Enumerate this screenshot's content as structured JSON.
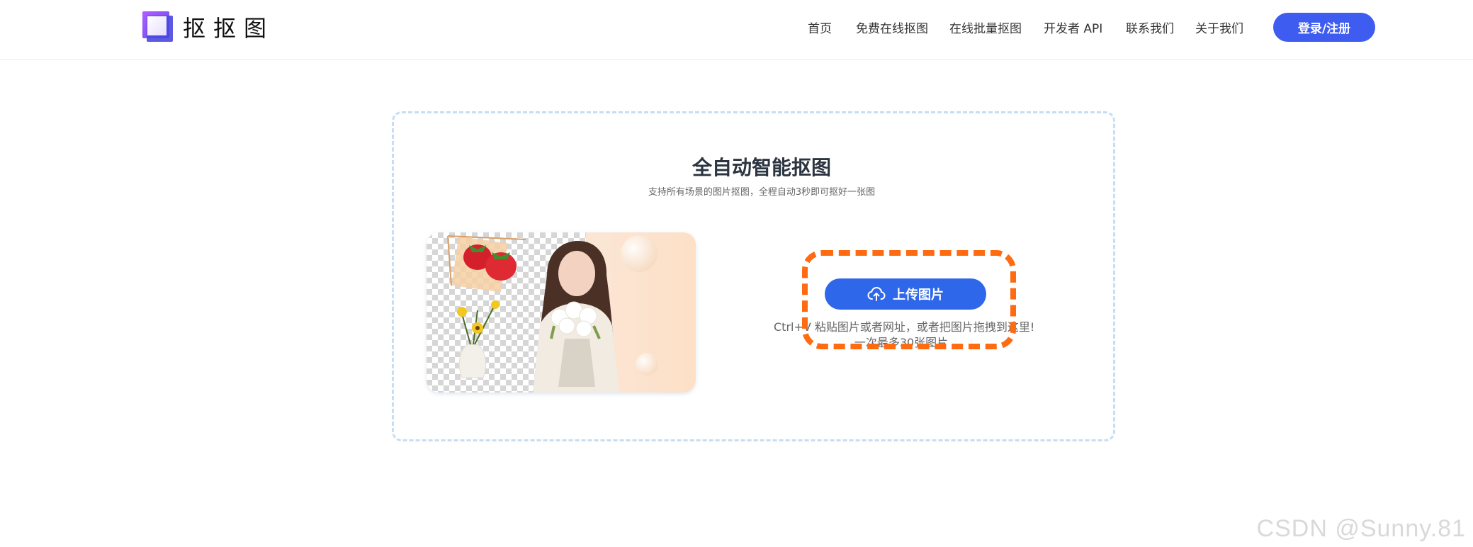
{
  "brand": {
    "name": "抠抠图",
    "accent_color": "#3e5cf0"
  },
  "nav": {
    "items": [
      {
        "label": "首页"
      },
      {
        "label": "免费在线抠图"
      },
      {
        "label": "在线批量抠图"
      },
      {
        "label": "开发者 API"
      },
      {
        "label": "联系我们"
      },
      {
        "label": "关于我们"
      }
    ],
    "login_label": "登录/注册"
  },
  "main": {
    "title": "全自动智能抠图",
    "subtitle": "支持所有场景的图片抠图，全程自动3秒即可抠好一张图",
    "upload_label": "上传图片",
    "upload_icon": "cloud-upload-icon",
    "hint_line1": "Ctrl+V 粘贴图片或者网址，或者把图片拖拽到这里!",
    "hint_line2": "一次最多30张图片",
    "button_color": "#2f67ea",
    "highlight_color": "#ff6b11"
  },
  "watermark": "CSDN @Sunny.81"
}
